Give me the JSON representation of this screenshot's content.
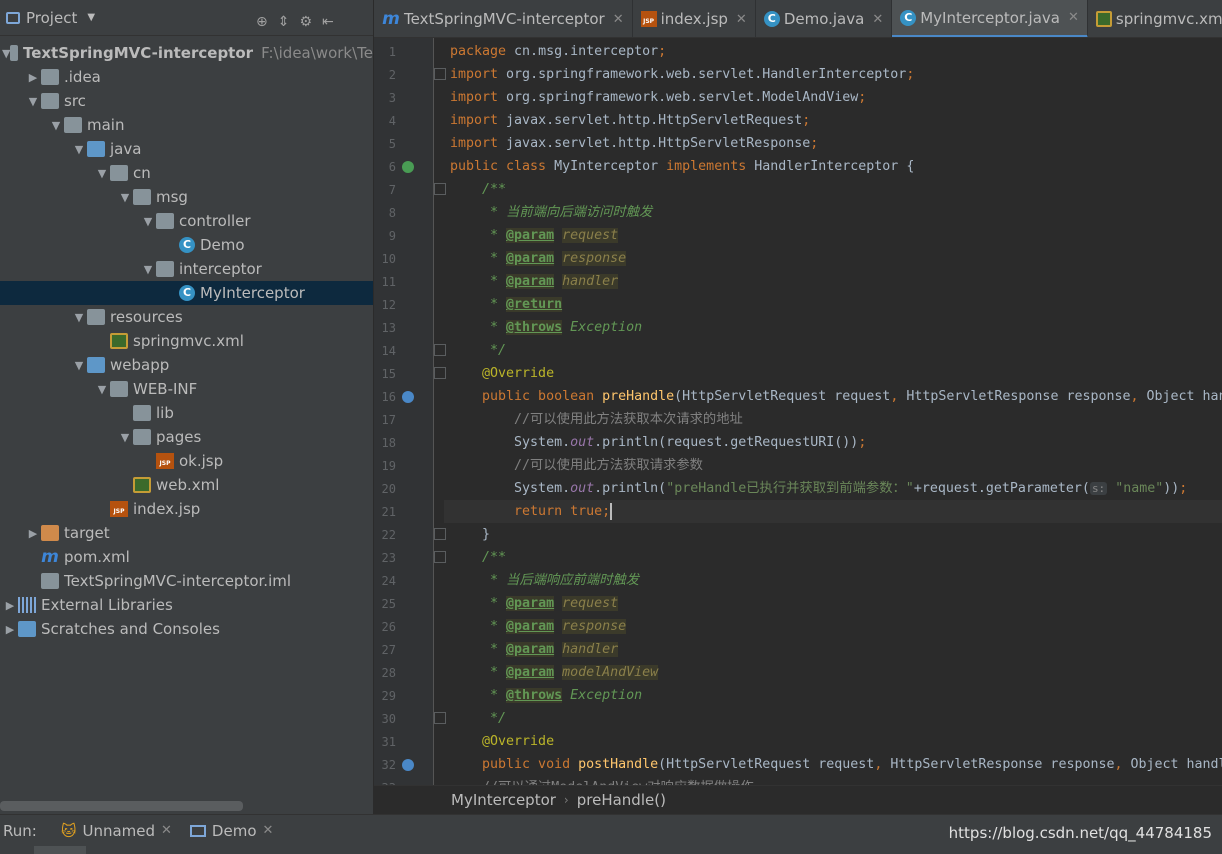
{
  "sidebar": {
    "title": "Project",
    "tree": [
      {
        "label": "TextSpringMVC-interceptor",
        "hint": "F:\\idea\\work\\Te",
        "icon": "module-folder-icon",
        "depth": 0,
        "arrow": "down",
        "bold": true
      },
      {
        "label": ".idea",
        "icon": "folder-icon",
        "depth": 1,
        "arrow": "right"
      },
      {
        "label": "src",
        "icon": "folder-icon",
        "depth": 1,
        "arrow": "down"
      },
      {
        "label": "main",
        "icon": "folder-icon",
        "depth": 2,
        "arrow": "down"
      },
      {
        "label": "java",
        "icon": "source-folder-icon",
        "depth": 3,
        "arrow": "down"
      },
      {
        "label": "cn",
        "icon": "package-icon",
        "depth": 4,
        "arrow": "down"
      },
      {
        "label": "msg",
        "icon": "package-icon",
        "depth": 5,
        "arrow": "down"
      },
      {
        "label": "controller",
        "icon": "package-icon",
        "depth": 6,
        "arrow": "down"
      },
      {
        "label": "Demo",
        "icon": "class-icon",
        "depth": 7,
        "arrow": ""
      },
      {
        "label": "interceptor",
        "icon": "package-icon",
        "depth": 6,
        "arrow": "down"
      },
      {
        "label": "MyInterceptor",
        "icon": "class-icon",
        "depth": 7,
        "arrow": "",
        "selected": true
      },
      {
        "label": "resources",
        "icon": "resources-folder-icon",
        "depth": 3,
        "arrow": "down"
      },
      {
        "label": "springmvc.xml",
        "icon": "xml-file-icon",
        "depth": 4,
        "arrow": ""
      },
      {
        "label": "webapp",
        "icon": "web-folder-icon",
        "depth": 3,
        "arrow": "down"
      },
      {
        "label": "WEB-INF",
        "icon": "folder-icon",
        "depth": 4,
        "arrow": "down"
      },
      {
        "label": "lib",
        "icon": "folder-icon",
        "depth": 5,
        "arrow": ""
      },
      {
        "label": "pages",
        "icon": "folder-icon",
        "depth": 5,
        "arrow": "down"
      },
      {
        "label": "ok.jsp",
        "icon": "jsp-file-icon",
        "depth": 6,
        "arrow": ""
      },
      {
        "label": "web.xml",
        "icon": "web-xml-icon",
        "depth": 5,
        "arrow": ""
      },
      {
        "label": "index.jsp",
        "icon": "jsp-file-icon",
        "depth": 4,
        "arrow": ""
      },
      {
        "label": "target",
        "icon": "excluded-folder-icon",
        "depth": 1,
        "arrow": "right"
      },
      {
        "label": "pom.xml",
        "icon": "maven-icon",
        "depth": 1,
        "arrow": ""
      },
      {
        "label": "TextSpringMVC-interceptor.iml",
        "icon": "iml-file-icon",
        "depth": 1,
        "arrow": ""
      },
      {
        "label": "External Libraries",
        "icon": "library-icon",
        "depth": 0,
        "arrow": "right"
      },
      {
        "label": "Scratches and Consoles",
        "icon": "scratches-icon",
        "depth": 0,
        "arrow": "right"
      }
    ]
  },
  "tabs": [
    {
      "label": "TextSpringMVC-interceptor",
      "icon": "maven-icon",
      "active": false
    },
    {
      "label": "index.jsp",
      "icon": "jsp-file-icon",
      "active": false
    },
    {
      "label": "Demo.java",
      "icon": "class-icon",
      "active": false
    },
    {
      "label": "MyInterceptor.java",
      "icon": "class-icon",
      "active": true
    },
    {
      "label": "springmvc.xm",
      "icon": "xml-file-icon",
      "active": false
    }
  ],
  "editor": {
    "current_line": 21,
    "lines": [
      [
        [
          "kw",
          "package "
        ],
        [
          "",
          "cn.msg.interceptor"
        ],
        [
          "kw",
          ";"
        ]
      ],
      [
        [
          "kw",
          "import "
        ],
        [
          "",
          "org.springframework.web.servlet.HandlerInterceptor"
        ],
        [
          "kw",
          ";"
        ]
      ],
      [
        [
          "kw",
          "import "
        ],
        [
          "",
          "org.springframework.web.servlet.ModelAndView"
        ],
        [
          "kw",
          ";"
        ]
      ],
      [
        [
          "kw",
          "import "
        ],
        [
          "",
          "javax.servlet.http.HttpServletRequest"
        ],
        [
          "kw",
          ";"
        ]
      ],
      [
        [
          "kw",
          "import "
        ],
        [
          "",
          "javax.servlet.http.HttpServletResponse"
        ],
        [
          "kw",
          ";"
        ]
      ],
      [
        [
          "kw",
          "public class "
        ],
        [
          "",
          "MyInterceptor "
        ],
        [
          "kw",
          "implements "
        ],
        [
          "",
          "HandlerInterceptor {"
        ]
      ],
      [
        [
          "cmt",
          "    /**"
        ]
      ],
      [
        [
          "cmt",
          "     * 当前端向后端访问时触发"
        ]
      ],
      [
        [
          "cmt",
          "     * "
        ],
        [
          "tag",
          "@param"
        ],
        [
          "cmt",
          " "
        ],
        [
          "pv",
          "request"
        ]
      ],
      [
        [
          "cmt",
          "     * "
        ],
        [
          "tag",
          "@param"
        ],
        [
          "cmt",
          " "
        ],
        [
          "pv",
          "response"
        ]
      ],
      [
        [
          "cmt",
          "     * "
        ],
        [
          "tag",
          "@param"
        ],
        [
          "cmt",
          " "
        ],
        [
          "pv",
          "handler"
        ]
      ],
      [
        [
          "cmt",
          "     * "
        ],
        [
          "tag",
          "@return"
        ]
      ],
      [
        [
          "cmt",
          "     * "
        ],
        [
          "tag",
          "@throws"
        ],
        [
          "cmt",
          " Exception"
        ]
      ],
      [
        [
          "cmt",
          "     */"
        ]
      ],
      [
        [
          "ann",
          "    @Override"
        ]
      ],
      [
        [
          "kw",
          "    public boolean "
        ],
        [
          "fn",
          "preHandle"
        ],
        [
          "",
          "(HttpServletRequest request"
        ],
        [
          "kw",
          ", "
        ],
        [
          "",
          "HttpServletResponse response"
        ],
        [
          "kw",
          ", "
        ],
        [
          "",
          "Object handler"
        ]
      ],
      [
        [
          "lcmt",
          "        //可以使用此方法获取本次请求的地址"
        ]
      ],
      [
        [
          "",
          "        System."
        ],
        [
          "fld",
          "out"
        ],
        [
          "",
          ".println(request.getRequestURI())"
        ],
        [
          "kw",
          ";"
        ]
      ],
      [
        [
          "lcmt",
          "        //可以使用此方法获取请求参数"
        ]
      ],
      [
        [
          "",
          "        System."
        ],
        [
          "fld",
          "out"
        ],
        [
          "",
          ".println("
        ],
        [
          "str",
          "\"preHandle已执行并获取到前端参数：\""
        ],
        [
          "",
          "+request.getParameter("
        ],
        [
          "hint",
          "s:"
        ],
        [
          "str",
          " \"name\""
        ],
        [
          "",
          "))"
        ],
        [
          "kw",
          ";"
        ]
      ],
      [
        [
          "kw",
          "        return true"
        ],
        [
          "kw",
          ";"
        ],
        [
          "caret",
          ""
        ]
      ],
      [
        [
          "",
          "    }"
        ]
      ],
      [
        [
          "cmt",
          "    /**"
        ]
      ],
      [
        [
          "cmt",
          "     * 当后端响应前端时触发"
        ]
      ],
      [
        [
          "cmt",
          "     * "
        ],
        [
          "tag",
          "@param"
        ],
        [
          "cmt",
          " "
        ],
        [
          "pv",
          "request"
        ]
      ],
      [
        [
          "cmt",
          "     * "
        ],
        [
          "tag",
          "@param"
        ],
        [
          "cmt",
          " "
        ],
        [
          "pv",
          "response"
        ]
      ],
      [
        [
          "cmt",
          "     * "
        ],
        [
          "tag",
          "@param"
        ],
        [
          "cmt",
          " "
        ],
        [
          "pv",
          "handler"
        ]
      ],
      [
        [
          "cmt",
          "     * "
        ],
        [
          "tag",
          "@param"
        ],
        [
          "cmt",
          " "
        ],
        [
          "pv",
          "modelAndView"
        ]
      ],
      [
        [
          "cmt",
          "     * "
        ],
        [
          "tag",
          "@throws"
        ],
        [
          "cmt",
          " Exception"
        ]
      ],
      [
        [
          "cmt",
          "     */"
        ]
      ],
      [
        [
          "ann",
          "    @Override"
        ]
      ],
      [
        [
          "kw",
          "    public void "
        ],
        [
          "fn",
          "postHandle"
        ],
        [
          "",
          "(HttpServletRequest request"
        ],
        [
          "kw",
          ", "
        ],
        [
          "",
          "HttpServletResponse response"
        ],
        [
          "kw",
          ", "
        ],
        [
          "",
          "Object handler"
        ]
      ],
      [
        [
          "lcmt",
          "    //可以通过ModelAndView对响应数据做操作"
        ]
      ]
    ]
  },
  "breadcrumb": {
    "class_name": "MyInterceptor",
    "method_name": "preHandle()"
  },
  "run": {
    "label": "Run:",
    "tabs": [
      {
        "label": "Unnamed",
        "icon": "tomcat-icon"
      },
      {
        "label": "Demo",
        "icon": "console-icon"
      }
    ]
  },
  "watermark": "https://blog.csdn.net/qq_44784185"
}
